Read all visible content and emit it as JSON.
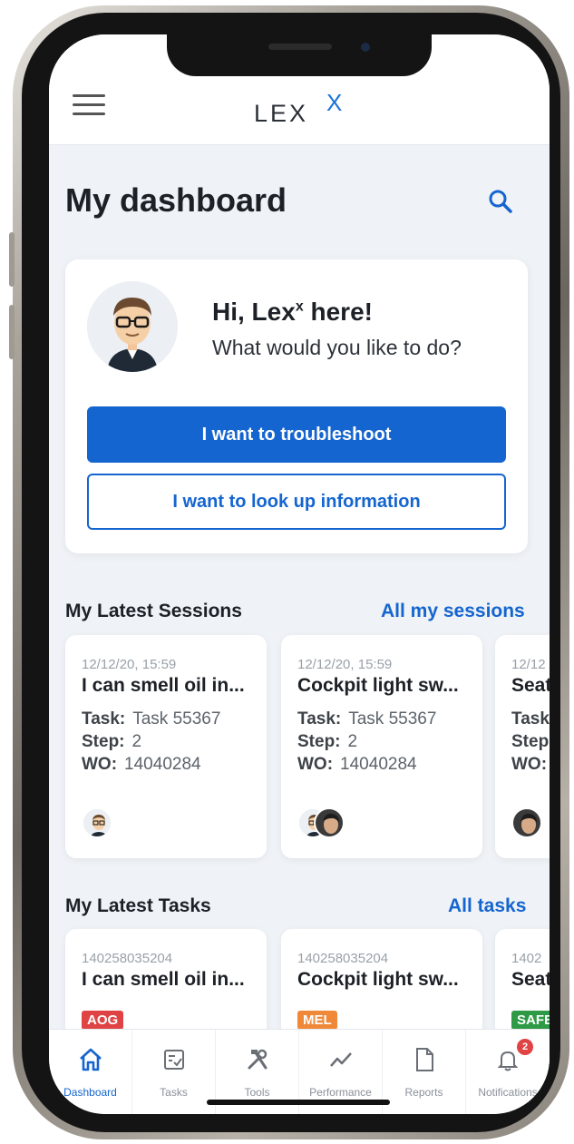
{
  "app": {
    "logo_text": "LEX",
    "logo_superscript": "X"
  },
  "header": {
    "title": "My dashboard"
  },
  "greeting": {
    "title": "Hi, Lex",
    "title_sup": "x",
    "title_suffix": " here!",
    "subtitle": "What would you like to do?",
    "primary_button": "I want to troubleshoot",
    "secondary_button": "I want to look up information"
  },
  "sessions": {
    "section_title": "My Latest Sessions",
    "link": "All my sessions",
    "labels": {
      "task": "Task:",
      "step": "Step:",
      "wo": "WO:"
    },
    "items": [
      {
        "date": "12/12/20, 15:59",
        "title": "I can smell oil in...",
        "task": "Task 55367",
        "step": "2",
        "wo": "14040284"
      },
      {
        "date": "12/12/20, 15:59",
        "title": "Cockpit light sw...",
        "task": "Task 55367",
        "step": "2",
        "wo": "14040284"
      },
      {
        "date": "12/12",
        "title": "Seat",
        "task": "",
        "step": "",
        "wo": ""
      }
    ]
  },
  "tasks": {
    "section_title": "My Latest Tasks",
    "link": "All tasks",
    "items": [
      {
        "id": "140258035204",
        "title": "I can smell oil in...",
        "tag": "AOG",
        "tag_color": "#e04343"
      },
      {
        "id": "140258035204",
        "title": "Cockpit light sw...",
        "tag": "MEL",
        "tag_color": "#f0883a"
      },
      {
        "id": "1402",
        "title": "Seat",
        "tag": "SAFE",
        "tag_color": "#2e9a45"
      }
    ]
  },
  "nav": {
    "items": [
      {
        "label": "Dashboard",
        "icon": "home-icon",
        "active": true
      },
      {
        "label": "Tasks",
        "icon": "tasks-icon"
      },
      {
        "label": "Tools",
        "icon": "tools-icon"
      },
      {
        "label": "Performance",
        "icon": "chart-icon"
      },
      {
        "label": "Reports",
        "icon": "document-icon"
      },
      {
        "label": "Notifications",
        "icon": "bell-icon",
        "badge": "2"
      }
    ]
  },
  "colors": {
    "primary": "#1565d0",
    "background": "#eff2f6",
    "text": "#1d2127"
  }
}
